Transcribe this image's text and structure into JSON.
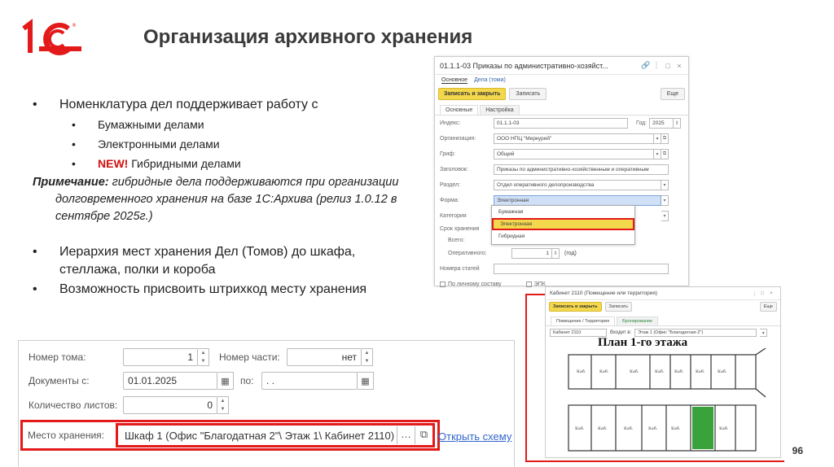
{
  "header": {
    "title": "Организация архивного хранения",
    "slide_number": "96"
  },
  "colors": {
    "brand_red": "#e21a1a",
    "accent_yellow": "#f3d74c",
    "link_blue": "#3366cc"
  },
  "bullets": {
    "b1": "Номенклатура дел поддерживает работу с",
    "b1_sub1": "Бумажными делами",
    "b1_sub2": "Электронными делами",
    "b1_sub3_new": "NEW!",
    "b1_sub3": " Гибридными делами",
    "note_label": "Примечание:",
    "note_text": " гибридные дела поддерживаются при организации долговременного хранения на базе 1С:Архива (релиз 1.0.12 в сентябре 2025г.)",
    "b2": "Иерархия мест хранения Дел (Томов) до шкафа, стеллажа, полки и короба",
    "b3": "Возможность присвоить штрихкод месту хранения"
  },
  "form1": {
    "title": "01.1.1-03 Приказы по административно-хозяйст...",
    "tab_main": "Основное",
    "tab_volumes": "Дела (тома)",
    "btn_save_close": "Записать и закрыть",
    "btn_save": "Записать",
    "btn_more": "Еще",
    "inner_tab_main": "Основные",
    "inner_tab_settings": "Настройка",
    "index_label": "Индекс:",
    "index_value": "01.1.1-03",
    "year_label": "Год:",
    "year_value": "2025",
    "org_label": "Организация:",
    "org_value": "ООО НПЦ \"Меркурий\"",
    "grif_label": "Гриф:",
    "grif_value": "Общий",
    "heading_label": "Заголовок:",
    "heading_value": "Приказы по административно-хозяйственным и оперативным",
    "section_label": "Раздел:",
    "section_value": "Отдел оперативного делопроизводства",
    "form_label": "Форма:",
    "form_value": "Электронная",
    "category_label": "Категория",
    "storage_label": "Срок хранения",
    "total_label": "Всего:",
    "operative_label": "Оперативного:",
    "operative_value": "1",
    "operative_unit": "(год)",
    "articles_label": "Номера статей",
    "personal_label": "По личному составу",
    "epk_label": "ЭПК",
    "dropdown": [
      "Бумажная",
      "Электронная",
      "Гибридная"
    ]
  },
  "form2": {
    "title": "Кабинет 2110 (Помещение или территория)",
    "btn_save_close": "Записать и закрыть",
    "btn_save": "Записать",
    "btn_more": "Еще",
    "tab1": "Помещение / Территория",
    "tab2": "Бронирование",
    "field_name": "Кабинет 2110",
    "field_parent_label": "Входит в:",
    "field_parent": "Этаж 1 (Офис \"Благодатная 2\")",
    "plan_title": "План 1-го этажа"
  },
  "form3": {
    "volume_label": "Номер тома:",
    "volume_value": "1",
    "part_label": "Номер части:",
    "part_value": "нет",
    "docs_label": "Документы с:",
    "docs_from": "01.01.2025",
    "to_label": "по:",
    "docs_to": ". .",
    "sheets_label": "Количество листов:",
    "sheets_value": "0",
    "place_label": "Место хранения:",
    "place_value": "Шкаф 1 (Офис \"Благодатная 2\"\\ Этаж 1\\ Кабинет 2110)",
    "open_scheme": "Открыть схему"
  }
}
